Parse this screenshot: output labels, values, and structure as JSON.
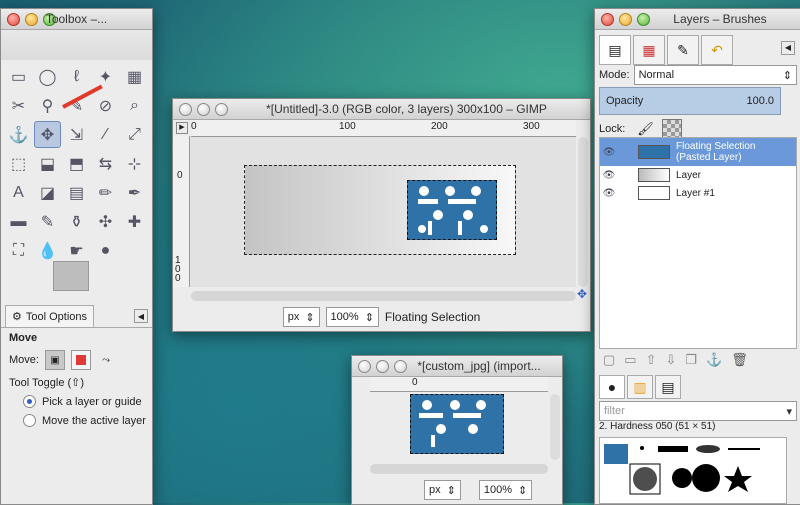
{
  "toolbox": {
    "title": "Toolbox –...",
    "tools": [
      "▭",
      "◯",
      "ℓ",
      "✦",
      "▦",
      "✂",
      "⚲",
      "✎",
      "⊘",
      "⌕",
      "⚓",
      "✥",
      "⇲",
      "∕",
      "⤢",
      "⬚",
      "⬓",
      "⬒",
      "⇆",
      "⊹",
      "A",
      "◪",
      "▤",
      "✏",
      "✒",
      "▬",
      "✎",
      "⚱",
      "✣",
      "✚",
      "⛶",
      "💧",
      "☛",
      "●"
    ],
    "tab_label": "Tool Options",
    "heading": "Move",
    "move_label": "Move:",
    "toggle_label": "Tool Toggle  (⇧)",
    "option1": "Pick a layer or guide",
    "option2": "Move the active layer"
  },
  "image_window": {
    "title": "*[Untitled]-3.0 (RGB color, 3 layers) 300x100 – GIMP",
    "ruler_h": [
      "0",
      "100",
      "200",
      "300"
    ],
    "ruler_v": [
      "0",
      "100"
    ],
    "unit": "px",
    "zoom": "100%",
    "status": "Floating Selection"
  },
  "jpg_window": {
    "title": "*[custom_jpg] (import...",
    "ruler_h": [
      "0"
    ],
    "unit": "px",
    "zoom": "100%"
  },
  "layers": {
    "title": "Layers – Brushes",
    "mode_label": "Mode:",
    "mode_value": "Normal",
    "opacity_label": "Opacity",
    "opacity_value": "100.0",
    "lock_label": "Lock:",
    "items": [
      {
        "name": "Floating Selection (Pasted Layer)"
      },
      {
        "name": "Layer"
      },
      {
        "name": "Layer #1"
      }
    ],
    "filter_placeholder": "filter",
    "brush_label": "2. Hardness 050 (51 × 51)"
  },
  "colors": {
    "accent": "#2f72a8",
    "selection": "#6a98d8"
  }
}
